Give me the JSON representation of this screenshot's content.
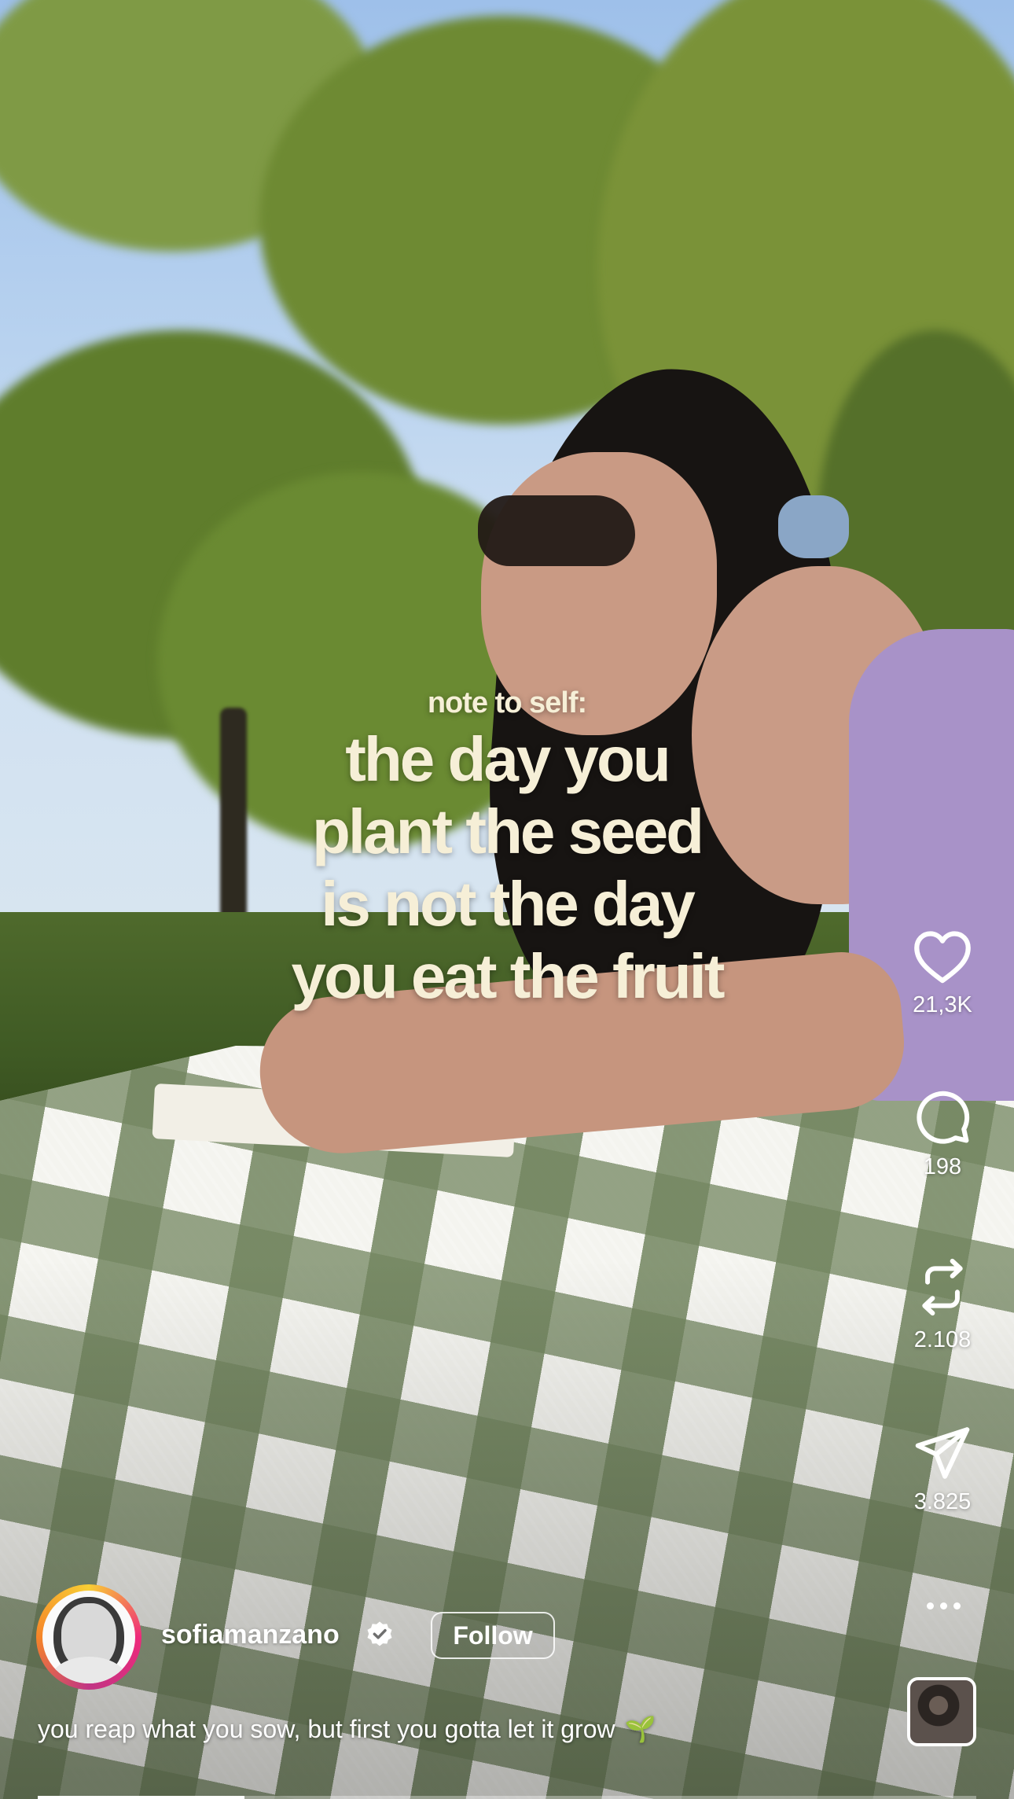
{
  "overlay": {
    "note_label": "note to self:",
    "quote_lines": [
      "the day you",
      "plant the seed",
      "is not the day",
      "you eat the fruit"
    ]
  },
  "actions": {
    "like": {
      "icon": "heart-icon",
      "count": "21,3K"
    },
    "comment": {
      "icon": "comment-bubble-icon",
      "count": "198"
    },
    "repost": {
      "icon": "repost-icon",
      "count": "2.108"
    },
    "share": {
      "icon": "paper-plane-icon",
      "count": "3.825"
    },
    "more": {
      "icon": "more-dots-icon"
    }
  },
  "author": {
    "username": "sofiamanzano",
    "verified": true,
    "follow_label": "Follow"
  },
  "caption": {
    "text": "you reap what you sow, but first you gotta let it grow",
    "emoji": "🌱"
  },
  "progress": {
    "fraction": 0.22
  },
  "colors": {
    "overlay_text": "#f6efd7",
    "icon": "#ffffff",
    "story_ring": [
      "#f9ce34",
      "#ee2a7b",
      "#c13584",
      "#f58529"
    ]
  }
}
